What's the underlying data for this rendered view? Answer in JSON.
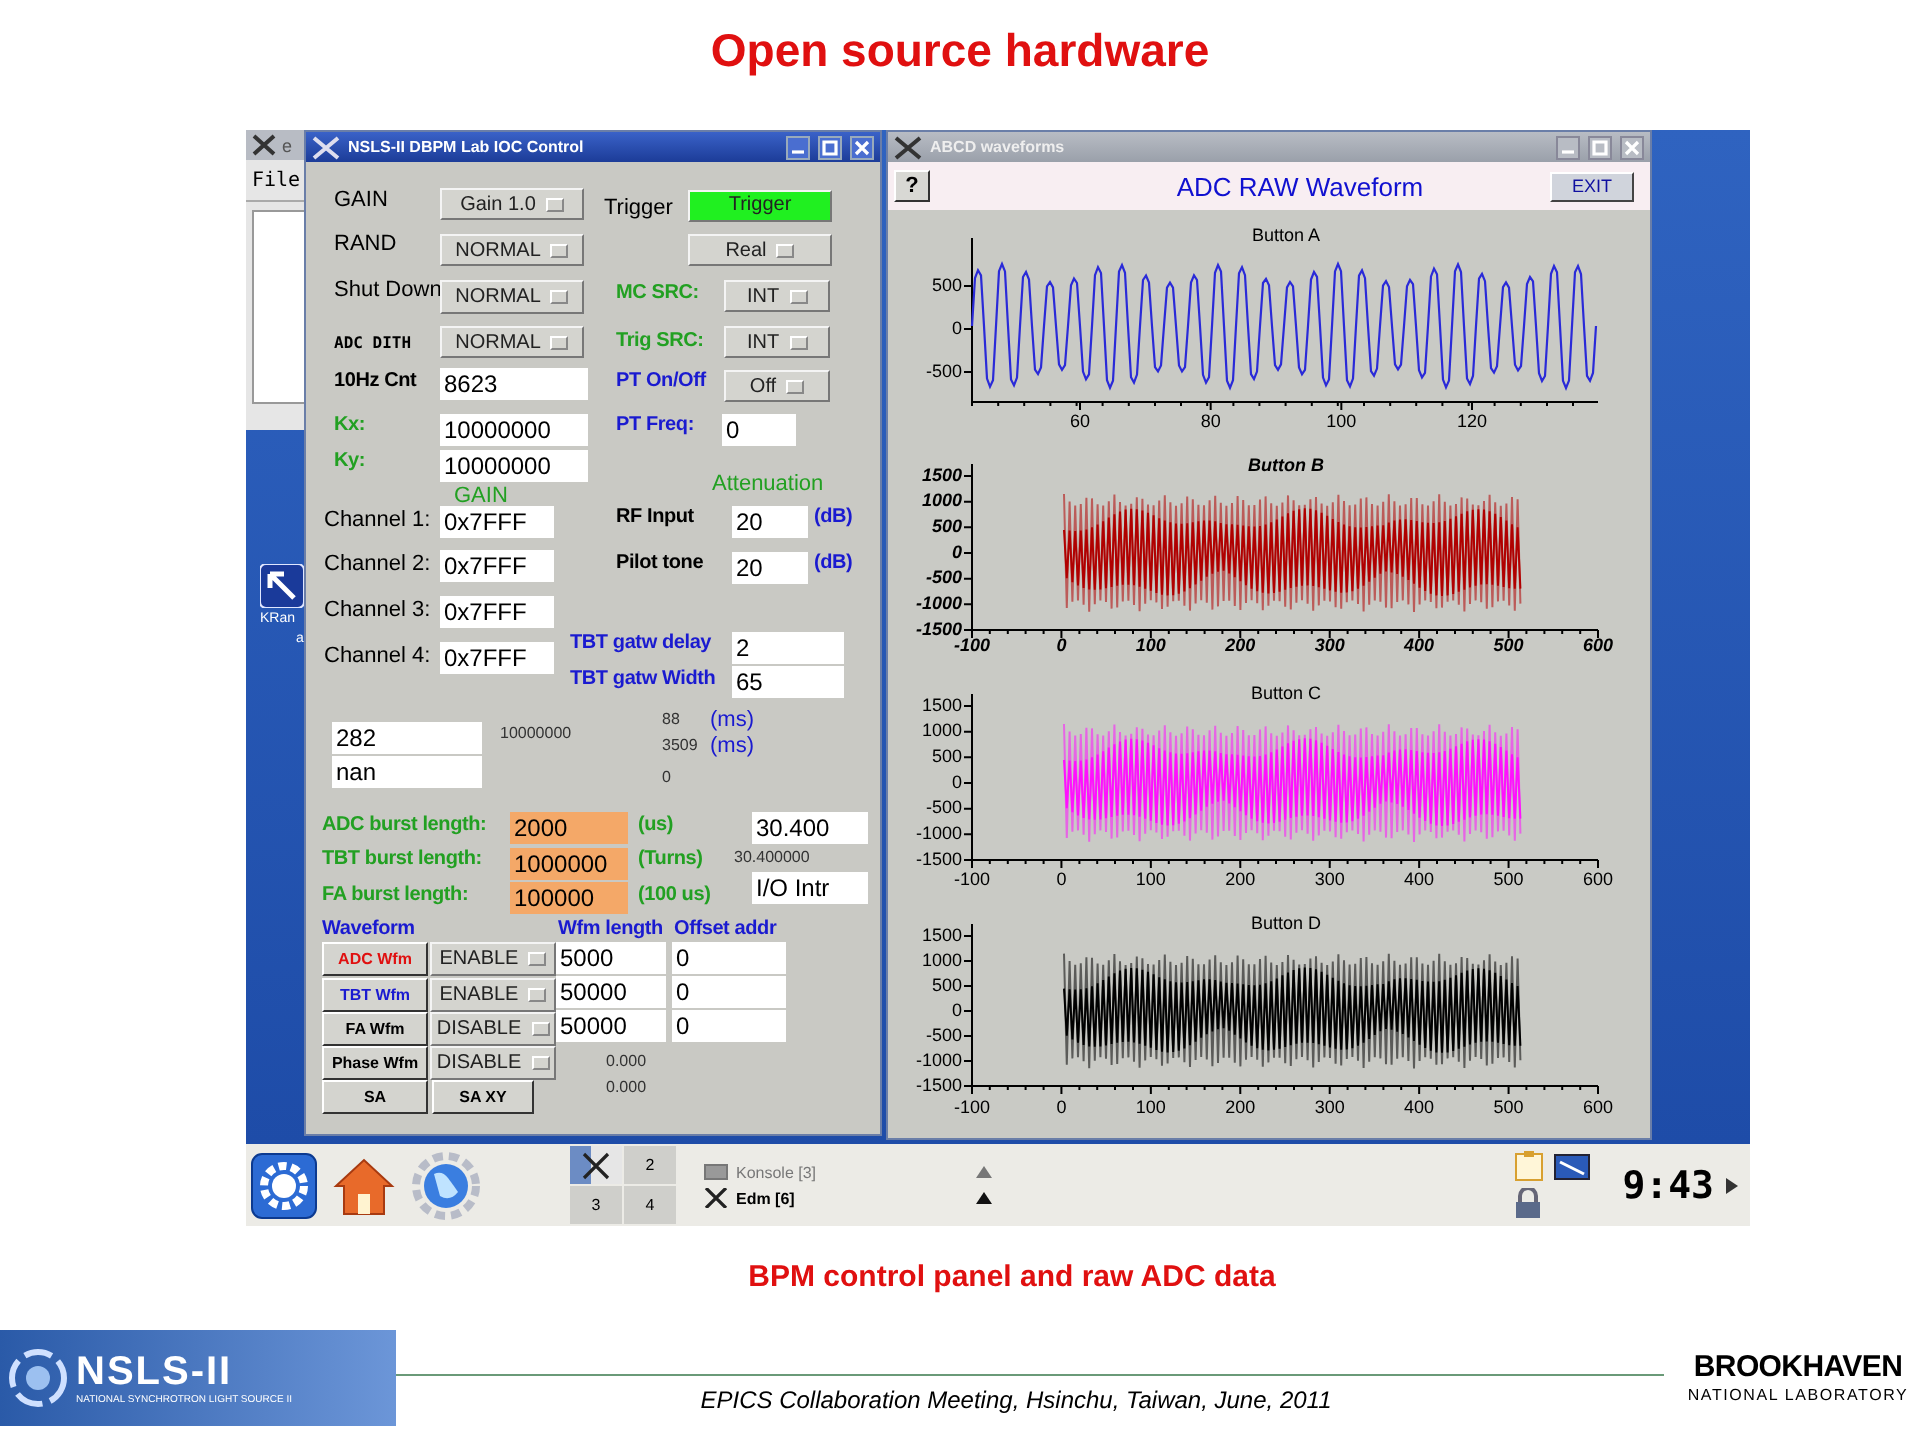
{
  "slide": {
    "title": "Open source hardware",
    "caption": "BPM control panel and raw ADC data",
    "footer": "EPICS Collaboration Meeting, Hsinchu, Taiwan, June, 2011",
    "logos": [
      {
        "kind": "nsls",
        "name": "NSLS-II",
        "tagline": "NATIONAL SYNCHROTRON LIGHT SOURCE II"
      },
      {
        "kind": "bnl",
        "name": "BROOKHAVEN",
        "tagline": "NATIONAL LABORATORY"
      }
    ]
  },
  "desktop": {
    "background_window": {
      "title": "e",
      "menu": [
        "File"
      ]
    },
    "icons": [
      {
        "label": "KRan",
        "sublabel": "a"
      }
    ]
  },
  "control_window": {
    "title": "NSLS-II DBPM Lab IOC Control",
    "active": true,
    "items": [
      {
        "kind": "label",
        "text": "GAIN",
        "color": "#000000",
        "bold": false
      },
      {
        "kind": "menu",
        "text": "Gain 1.0"
      },
      {
        "kind": "label",
        "text": "Trigger",
        "color": "#000000",
        "bold": false
      },
      {
        "kind": "toggle",
        "text": "Trigger",
        "on": true
      },
      {
        "kind": "label",
        "text": "RAND",
        "color": "#000000",
        "bold": false
      },
      {
        "kind": "menu",
        "text": "NORMAL"
      },
      {
        "kind": "menu",
        "text": "Real"
      },
      {
        "kind": "label",
        "text": "Shut Down",
        "color": "#000000",
        "bold": false
      },
      {
        "kind": "menu",
        "text": "NORMAL"
      },
      {
        "kind": "label",
        "text": "MC SRC:",
        "color": "#22a022",
        "bold": true
      },
      {
        "kind": "menu",
        "text": "INT"
      },
      {
        "kind": "code",
        "text": "ADC DITH"
      },
      {
        "kind": "menu",
        "text": "NORMAL"
      },
      {
        "kind": "label",
        "text": "Trig SRC:",
        "color": "#22a022",
        "bold": true
      },
      {
        "kind": "menu",
        "text": "INT"
      },
      {
        "kind": "label",
        "text": "10Hz Cnt",
        "color": "#000000",
        "bold": true
      },
      {
        "kind": "field",
        "text": "8623"
      },
      {
        "kind": "label",
        "text": "PT On/Off",
        "color": "#1a1ad0",
        "bold": true
      },
      {
        "kind": "menu",
        "text": "Off"
      },
      {
        "kind": "label",
        "text": "Kx:",
        "color": "#22a022",
        "bold": true
      },
      {
        "kind": "field",
        "text": "10000000"
      },
      {
        "kind": "label",
        "text": "PT Freq:",
        "color": "#1a1ad0",
        "bold": true
      },
      {
        "kind": "field",
        "text": "0"
      },
      {
        "kind": "label",
        "text": "Ky:",
        "color": "#22a022",
        "bold": true
      },
      {
        "kind": "field",
        "text": "10000000"
      },
      {
        "kind": "label",
        "text": "GAIN",
        "color": "#22a022",
        "bold": false
      },
      {
        "kind": "label",
        "text": "Attenuation",
        "color": "#22a022",
        "bold": false
      },
      {
        "kind": "label",
        "text": "Channel 1:",
        "color": "#000000",
        "bold": false
      },
      {
        "kind": "field",
        "text": "0x7FFF"
      },
      {
        "kind": "label",
        "text": "RF Input",
        "color": "#000000",
        "bold": true
      },
      {
        "kind": "field",
        "text": "20"
      },
      {
        "kind": "label",
        "text": "(dB)",
        "color": "#1a1ad0",
        "bold": true
      },
      {
        "kind": "label",
        "text": "Channel 2:",
        "color": "#000000",
        "bold": false
      },
      {
        "kind": "field",
        "text": "0x7FFF"
      },
      {
        "kind": "label",
        "text": "Pilot tone",
        "color": "#000000",
        "bold": true
      },
      {
        "kind": "field",
        "text": "20"
      },
      {
        "kind": "label",
        "text": "(dB)",
        "color": "#1a1ad0",
        "bold": true
      },
      {
        "kind": "label",
        "text": "Channel 3:",
        "color": "#000000",
        "bold": false
      },
      {
        "kind": "field",
        "text": "0x7FFF"
      },
      {
        "kind": "label",
        "text": "Channel 4:",
        "color": "#000000",
        "bold": false
      },
      {
        "kind": "field",
        "text": "0x7FFF"
      },
      {
        "kind": "label",
        "text": "TBT gatw delay",
        "color": "#1a1ad0",
        "bold": true
      },
      {
        "kind": "field",
        "text": "2"
      },
      {
        "kind": "label",
        "text": "TBT gatw Width",
        "color": "#1a1ad0",
        "bold": true
      },
      {
        "kind": "field",
        "text": "65"
      },
      {
        "kind": "field",
        "text": "282"
      },
      {
        "kind": "small",
        "text": "10000000"
      },
      {
        "kind": "small",
        "text": "88"
      },
      {
        "kind": "label",
        "text": "(ms)",
        "color": "#1a1ad0",
        "bold": false
      },
      {
        "kind": "small",
        "text": "3509"
      },
      {
        "kind": "label",
        "text": "(ms)",
        "color": "#1a1ad0",
        "bold": false
      },
      {
        "kind": "field",
        "text": "nan"
      },
      {
        "kind": "small",
        "text": "0"
      },
      {
        "kind": "label",
        "text": "ADC burst length:",
        "color": "#22a022",
        "bold": true
      },
      {
        "kind": "entry",
        "text": "2000"
      },
      {
        "kind": "label",
        "text": "(us)",
        "color": "#22a022",
        "bold": true
      },
      {
        "kind": "field",
        "text": "30.400"
      },
      {
        "kind": "label",
        "text": "TBT burst length:",
        "color": "#22a022",
        "bold": true
      },
      {
        "kind": "entry",
        "text": "1000000"
      },
      {
        "kind": "label",
        "text": "(Turns)",
        "color": "#22a022",
        "bold": true
      },
      {
        "kind": "small",
        "text": "30.400000"
      },
      {
        "kind": "label",
        "text": "FA burst length:",
        "color": "#22a022",
        "bold": true
      },
      {
        "kind": "entry",
        "text": "100000"
      },
      {
        "kind": "label",
        "text": "(100 us)",
        "color": "#22a022",
        "bold": true
      },
      {
        "kind": "field",
        "text": "I/O Intr"
      },
      {
        "kind": "label",
        "text": "Waveform",
        "color": "#1a1ad0",
        "bold": true
      },
      {
        "kind": "label",
        "text": "Wfm length",
        "color": "#1a1ad0",
        "bold": true
      },
      {
        "kind": "label",
        "text": "Offset addr",
        "color": "#1a1ad0",
        "bold": true
      },
      {
        "kind": "button",
        "text": "ADC Wfm",
        "color": "#e01010"
      },
      {
        "kind": "menu",
        "text": "ENABLE"
      },
      {
        "kind": "field",
        "text": "5000"
      },
      {
        "kind": "field",
        "text": "0"
      },
      {
        "kind": "button",
        "text": "TBT Wfm",
        "color": "#1a1ad0"
      },
      {
        "kind": "menu",
        "text": "ENABLE"
      },
      {
        "kind": "field",
        "text": "50000"
      },
      {
        "kind": "field",
        "text": "0"
      },
      {
        "kind": "button",
        "text": "FA Wfm",
        "color": "#000000"
      },
      {
        "kind": "menu",
        "text": "DISABLE"
      },
      {
        "kind": "field",
        "text": "50000"
      },
      {
        "kind": "field",
        "text": "0"
      },
      {
        "kind": "button",
        "text": "Phase Wfm",
        "color": "#000000"
      },
      {
        "kind": "menu",
        "text": "DISABLE"
      },
      {
        "kind": "small",
        "text": "0.000"
      },
      {
        "kind": "small",
        "text": "0.000"
      },
      {
        "kind": "button",
        "text": "SA",
        "color": "#000000"
      },
      {
        "kind": "button",
        "text": "SA XY",
        "color": "#000000"
      }
    ]
  },
  "waveform_window": {
    "title": "ABCD waveforms",
    "active": false,
    "help_button": "?",
    "heading": "ADC RAW Waveform",
    "exit_button": "EXIT",
    "plots": [
      {
        "title": "Button A",
        "kind": "plain",
        "color": "#2a2ad8",
        "xticks": [
          "60",
          "80",
          "100",
          "120"
        ],
        "yticks": [
          "500",
          "0",
          "-500"
        ]
      },
      {
        "title": "Button B",
        "kind": "italic",
        "color": "#b00000",
        "xticks": [
          "-100",
          "0",
          "100",
          "200",
          "300",
          "400",
          "500",
          "600"
        ],
        "yticks": [
          "1500",
          "1000",
          "500",
          "0",
          "-500",
          "-1000",
          "-1500"
        ]
      },
      {
        "title": "Button C",
        "kind": "plain",
        "color": "#ff10ff",
        "xticks": [
          "-100",
          "0",
          "100",
          "200",
          "300",
          "400",
          "500",
          "600"
        ],
        "yticks": [
          "1500",
          "1000",
          "500",
          "0",
          "-500",
          "-1000",
          "-1500"
        ]
      },
      {
        "title": "Button D",
        "kind": "plain",
        "color": "#000000",
        "xticks": [
          "-100",
          "0",
          "100",
          "200",
          "300",
          "400",
          "500",
          "600"
        ],
        "yticks": [
          "1500",
          "1000",
          "500",
          "0",
          "-500",
          "-1000",
          "-1500"
        ]
      }
    ]
  },
  "taskbar": {
    "pager": [
      "2",
      "3",
      "4"
    ],
    "tasks": [
      {
        "label": "Konsole [3]",
        "selected": false
      },
      {
        "label": "Edm [6]",
        "selected": true
      }
    ],
    "clock": "9:43"
  }
}
